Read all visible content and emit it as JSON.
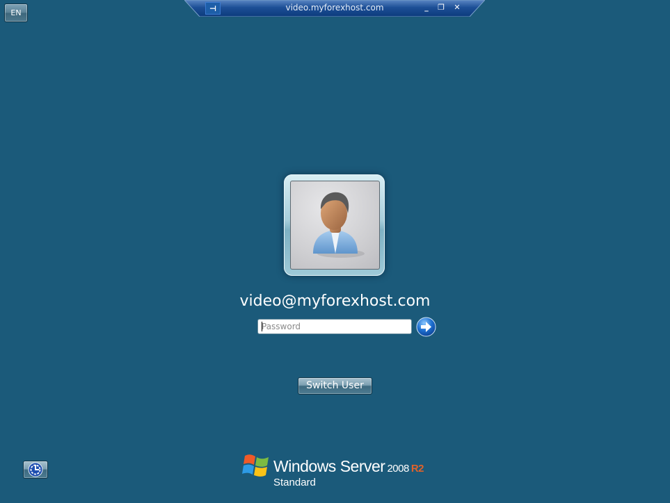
{
  "connection_bar": {
    "title": "video.myforexhost.com",
    "pin_icon": "pin-icon",
    "minimize_icon": "minimize-icon",
    "restore_icon": "restore-icon",
    "close_icon": "close-icon",
    "pin_glyph": "⊣",
    "minimize_glyph": "_",
    "restore_glyph": "❐",
    "close_glyph": "✕"
  },
  "language": {
    "label": "EN"
  },
  "user": {
    "avatar_icon": "user-avatar-icon",
    "name": "video@myforexhost.com"
  },
  "password": {
    "value": "",
    "placeholder": "Password"
  },
  "actions": {
    "submit_icon": "arrow-right-icon",
    "switch_user_label": "Switch User",
    "ease_of_access_icon": "ease-of-access-icon"
  },
  "branding": {
    "product": "Windows Server",
    "version": "2008",
    "release": "R2",
    "edition": "Standard",
    "logo_icon": "windows-flag-icon"
  },
  "colors": {
    "background": "#1b5a7a",
    "bar": "#0e3f82",
    "release_accent": "#e0622a"
  }
}
